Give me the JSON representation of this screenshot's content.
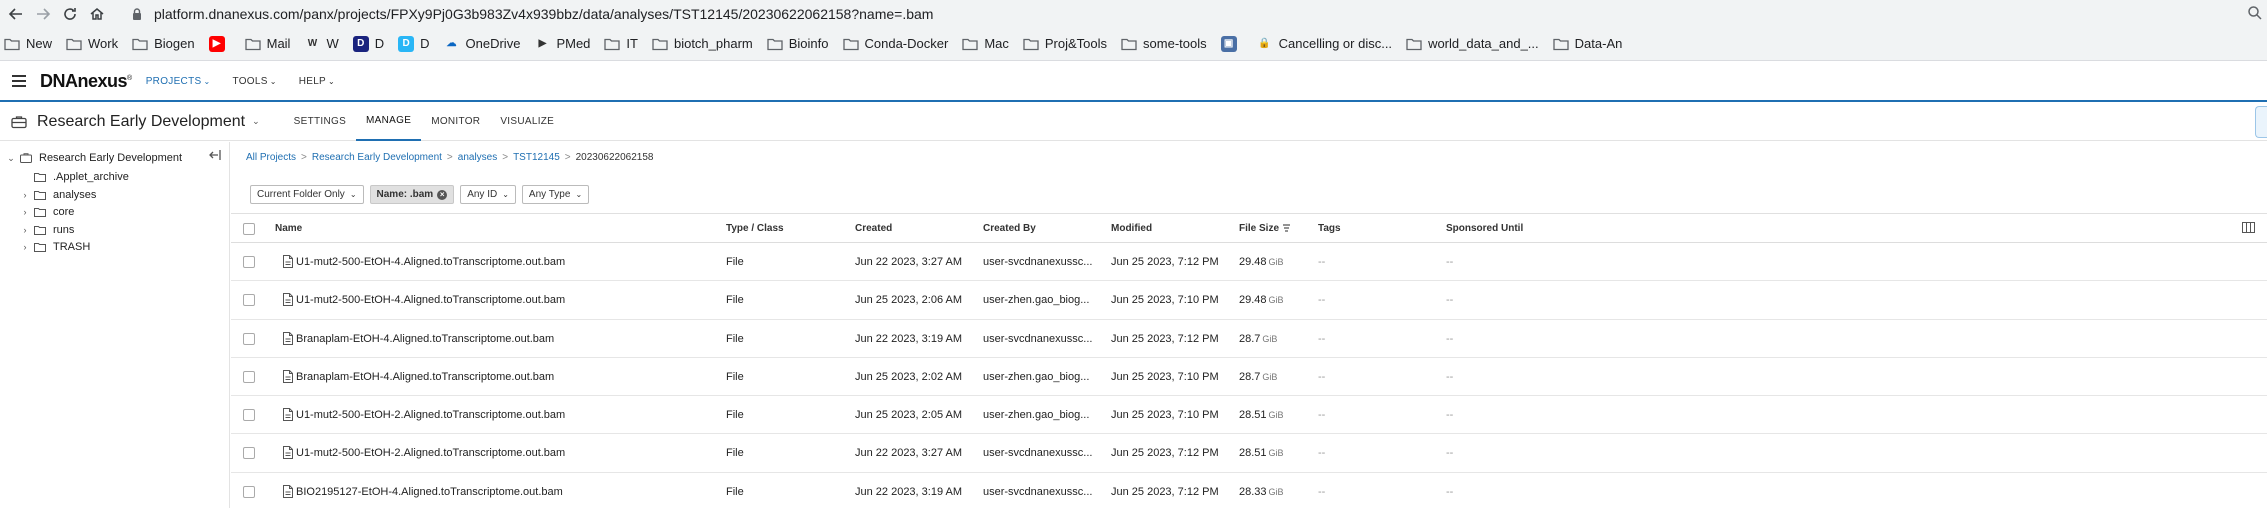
{
  "browser": {
    "url": "platform.dnanexus.com/panx/projects/FPXy9Pj0G3b983Zv4x939bbz/data/analyses/TST12145/20230622062158?name=.bam",
    "bookmarks": [
      {
        "label": "New",
        "kind": "folder"
      },
      {
        "label": "Work",
        "kind": "folder"
      },
      {
        "label": "Biogen",
        "kind": "folder"
      },
      {
        "label": "",
        "kind": "youtube"
      },
      {
        "label": "Mail",
        "kind": "folder"
      },
      {
        "label": "W",
        "kind": "wiki"
      },
      {
        "label": "D",
        "kind": "d-square"
      },
      {
        "label": "D",
        "kind": "d-round"
      },
      {
        "label": "OneDrive",
        "kind": "cloud"
      },
      {
        "label": "PMed",
        "kind": "pmed"
      },
      {
        "label": "IT",
        "kind": "folder"
      },
      {
        "label": "biotch_pharm",
        "kind": "folder"
      },
      {
        "label": "Bioinfo",
        "kind": "folder"
      },
      {
        "label": "Conda-Docker",
        "kind": "folder"
      },
      {
        "label": "Mac",
        "kind": "folder"
      },
      {
        "label": "Proj&Tools",
        "kind": "folder"
      },
      {
        "label": "some-tools",
        "kind": "folder"
      },
      {
        "label": "",
        "kind": "image"
      },
      {
        "label": "Cancelling or disc...",
        "kind": "lock-red"
      },
      {
        "label": "world_data_and_...",
        "kind": "folder"
      },
      {
        "label": "Data-An",
        "kind": "folder"
      }
    ]
  },
  "app": {
    "logo": "DNAnexus",
    "nav": [
      {
        "label": "PROJECTS",
        "active": true
      },
      {
        "label": "TOOLS",
        "active": false
      },
      {
        "label": "HELP",
        "active": false
      }
    ],
    "accent": "#1f6fb2"
  },
  "project": {
    "title": "Research Early Development",
    "tabs": [
      {
        "label": "SETTINGS",
        "active": false
      },
      {
        "label": "MANAGE",
        "active": true
      },
      {
        "label": "MONITOR",
        "active": false
      },
      {
        "label": "VISUALIZE",
        "active": false
      }
    ]
  },
  "tree": {
    "root": "Research Early Development",
    "items": [
      {
        "label": ".Applet_archive",
        "expandable": false
      },
      {
        "label": "analyses",
        "expandable": true
      },
      {
        "label": "core",
        "expandable": true
      },
      {
        "label": "runs",
        "expandable": true
      },
      {
        "label": "TRASH",
        "expandable": true
      }
    ]
  },
  "breadcrumb": {
    "links": [
      "All Projects",
      "Research Early Development",
      "analyses",
      "TST12145"
    ],
    "current": "20230622062158"
  },
  "filters": {
    "folder": "Current Folder Only",
    "name": "Name: .bam",
    "id": "Any ID",
    "type": "Any Type"
  },
  "table": {
    "headers": {
      "name": "Name",
      "type": "Type / Class",
      "created": "Created",
      "created_by": "Created By",
      "modified": "Modified",
      "size": "File Size",
      "tags": "Tags",
      "sponsored": "Sponsored Until"
    },
    "rows": [
      {
        "name": "U1-mut2-500-EtOH-4.Aligned.toTranscriptome.out.bam",
        "type": "File",
        "created": "Jun 22 2023, 3:27 AM",
        "created_by": "user-svcdnanexussc...",
        "modified": "Jun 25 2023, 7:12 PM",
        "size": "29.48",
        "unit": "GiB",
        "tags": "--",
        "sponsored": "--"
      },
      {
        "name": "U1-mut2-500-EtOH-4.Aligned.toTranscriptome.out.bam",
        "type": "File",
        "created": "Jun 25 2023, 2:06 AM",
        "created_by": "user-zhen.gao_biog...",
        "modified": "Jun 25 2023, 7:10 PM",
        "size": "29.48",
        "unit": "GiB",
        "tags": "--",
        "sponsored": "--"
      },
      {
        "name": "Branaplam-EtOH-4.Aligned.toTranscriptome.out.bam",
        "type": "File",
        "created": "Jun 22 2023, 3:19 AM",
        "created_by": "user-svcdnanexussc...",
        "modified": "Jun 25 2023, 7:12 PM",
        "size": "28.7",
        "unit": "GiB",
        "tags": "--",
        "sponsored": "--"
      },
      {
        "name": "Branaplam-EtOH-4.Aligned.toTranscriptome.out.bam",
        "type": "File",
        "created": "Jun 25 2023, 2:02 AM",
        "created_by": "user-zhen.gao_biog...",
        "modified": "Jun 25 2023, 7:10 PM",
        "size": "28.7",
        "unit": "GiB",
        "tags": "--",
        "sponsored": "--"
      },
      {
        "name": "U1-mut2-500-EtOH-2.Aligned.toTranscriptome.out.bam",
        "type": "File",
        "created": "Jun 25 2023, 2:05 AM",
        "created_by": "user-zhen.gao_biog...",
        "modified": "Jun 25 2023, 7:10 PM",
        "size": "28.51",
        "unit": "GiB",
        "tags": "--",
        "sponsored": "--"
      },
      {
        "name": "U1-mut2-500-EtOH-2.Aligned.toTranscriptome.out.bam",
        "type": "File",
        "created": "Jun 22 2023, 3:27 AM",
        "created_by": "user-svcdnanexussc...",
        "modified": "Jun 25 2023, 7:12 PM",
        "size": "28.51",
        "unit": "GiB",
        "tags": "--",
        "sponsored": "--"
      },
      {
        "name": "BIO2195127-EtOH-4.Aligned.toTranscriptome.out.bam",
        "type": "File",
        "created": "Jun 22 2023, 3:19 AM",
        "created_by": "user-svcdnanexussc...",
        "modified": "Jun 25 2023, 7:12 PM",
        "size": "28.33",
        "unit": "GiB",
        "tags": "--",
        "sponsored": "--"
      }
    ]
  }
}
